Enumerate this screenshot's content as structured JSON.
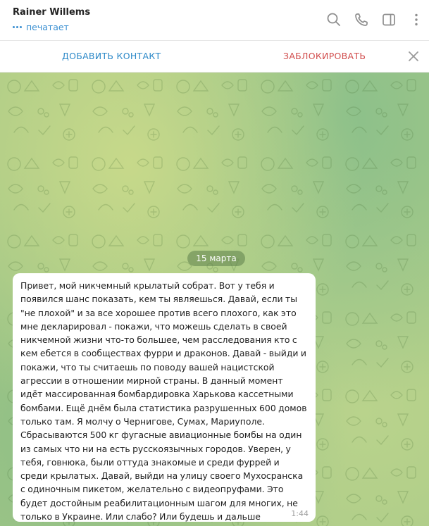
{
  "header": {
    "contact_name": "Rainer Willems",
    "status": "печатает",
    "icons": [
      "search-icon",
      "phone-icon",
      "sidebar-toggle-icon",
      "more-vertical-icon"
    ]
  },
  "action_bar": {
    "add_contact_label": "ДОБАВИТЬ КОНТАКТ",
    "block_label": "ЗАБЛОКИРОВАТЬ"
  },
  "chat": {
    "date_label": "15 марта",
    "messages": [
      {
        "text": "Привет, мой никчемный крылатый собрат. Вот у тебя и появился шанс показать, кем ты являешься. Давай, если ты \"не плохой\" и за все хорошее против всего плохого, как это мне декларировал - покажи, что можешь сделать в своей никчемной жизни что-то большее, чем расследования кто с кем ебется в сообществах фурри и драконов. Давай - выйди и покажи, что ты считаешь по поводу вашей нацистской агрессии в отношении мирной страны. В данный момент идёт массированная бомбардировка Харькова кассетными бомбами. Ещё днём была статистика разрушенных 600 домов только там. Я молчу о Чернигове, Сумах, Мариуполе. Сбрасываются 500 кг фугасные авиационные бомбы на один из самых что ни на есть русскоязычных городов. Уверен, у тебя, говнюка, были оттуда знакомые и среди фуррей и среди крылатых. Давай, выйди на улицу своего Мухосранска с одиночным пикетом, желательно с видеопруфами. Это будет достойным реабилитационным шагом для многих, не только в Украине. Или слабо? Или будешь и дальше кукарекать в сети?",
        "time": "1:44"
      }
    ]
  },
  "colors": {
    "accent": "#3a8fd1",
    "danger": "#d14d4d",
    "wallpaper": "#a8c987"
  }
}
